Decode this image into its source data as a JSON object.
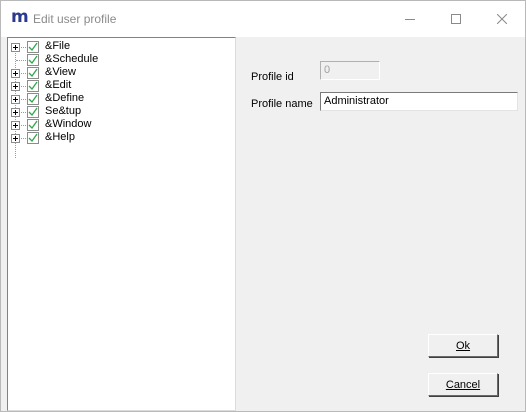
{
  "window": {
    "logo_letter": "m",
    "title": "Edit user profile",
    "minimize_glyph": "—",
    "maximize_glyph": "☐",
    "close_glyph": "✕"
  },
  "tree": {
    "items": [
      {
        "label": "&File",
        "expandable": true
      },
      {
        "label": "&Schedule",
        "expandable": false
      },
      {
        "label": "&View",
        "expandable": true
      },
      {
        "label": "&Edit",
        "expandable": true
      },
      {
        "label": "&Define",
        "expandable": true
      },
      {
        "label": "Se&tup",
        "expandable": true
      },
      {
        "label": "&Window",
        "expandable": true
      },
      {
        "label": "&Help",
        "expandable": true
      }
    ],
    "check_color": "#2ea84a"
  },
  "form": {
    "profile_id_label": "Profile id",
    "profile_id_value": "0",
    "profile_name_label": "Profile name",
    "profile_name_value": "Administrator"
  },
  "buttons": {
    "ok_label": "Ok",
    "cancel_label": "Cancel"
  }
}
